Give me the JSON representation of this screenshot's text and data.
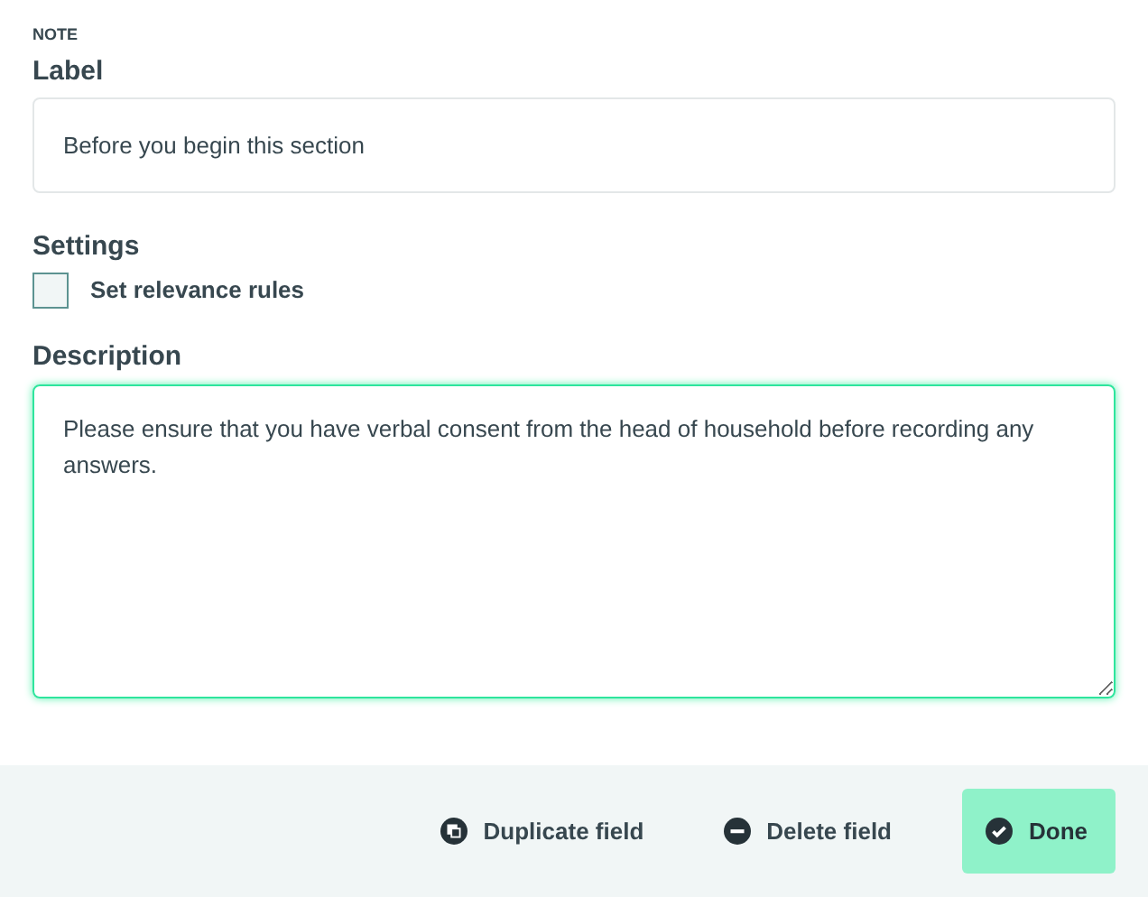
{
  "field_type": "NOTE",
  "label": {
    "title": "Label",
    "value": "Before you begin this section"
  },
  "settings": {
    "title": "Settings",
    "options": [
      {
        "label": "Set relevance rules",
        "checked": false
      }
    ]
  },
  "description": {
    "title": "Description",
    "value": "Please ensure that you have verbal consent from the head of household before recording any answers.",
    "focused": true
  },
  "actions": [
    {
      "kind": "duplicate",
      "label": "Duplicate field"
    },
    {
      "kind": "delete",
      "label": "Delete field"
    },
    {
      "kind": "done",
      "label": "Done"
    }
  ]
}
